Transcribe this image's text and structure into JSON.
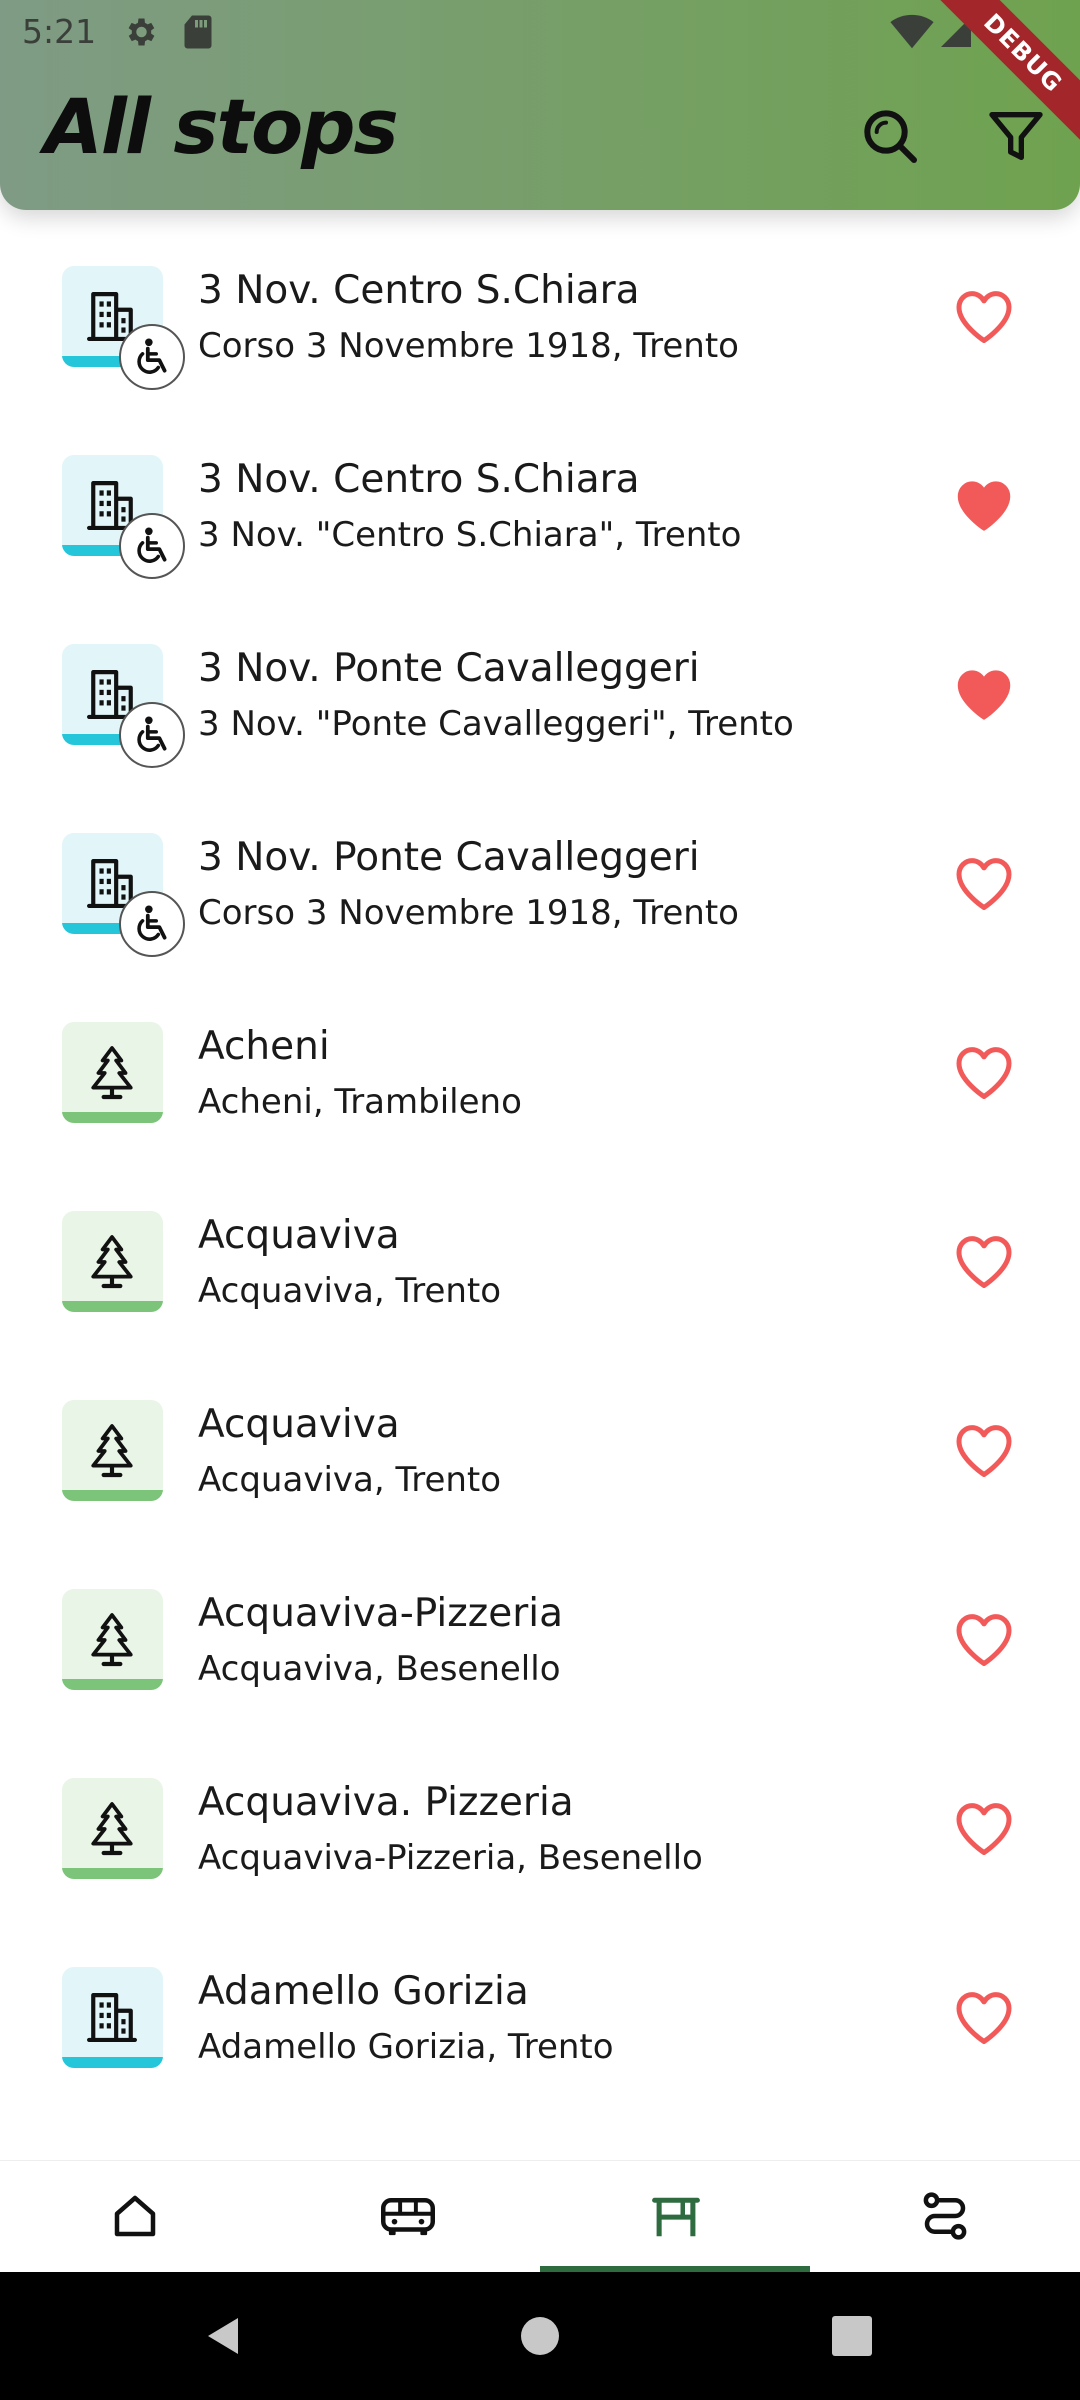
{
  "status_bar": {
    "time": "5:21"
  },
  "app_bar": {
    "title": "All stops",
    "debug_banner": "DEBUG"
  },
  "colors": {
    "urban_tile": "#e2f5f8",
    "urban_accent": "#26c6da",
    "rural_tile": "#e9f5e7",
    "rural_accent": "#7cc47a",
    "favorite": "#f25a5a",
    "nav_active": "#2e6b3f"
  },
  "stops": [
    {
      "name": "3 Nov. Centro S.Chiara",
      "address": "Corso 3 Novembre 1918, Trento",
      "type": "urban",
      "icon": "building-icon",
      "accessible": true,
      "favorite": false
    },
    {
      "name": "3 Nov. Centro S.Chiara",
      "address": "3 Nov. \"Centro S.Chiara\", Trento",
      "type": "urban",
      "icon": "building-icon",
      "accessible": true,
      "favorite": true
    },
    {
      "name": "3 Nov. Ponte Cavalleggeri",
      "address": "3 Nov. \"Ponte Cavalleggeri\", Trento",
      "type": "urban",
      "icon": "building-icon",
      "accessible": true,
      "favorite": true
    },
    {
      "name": "3 Nov. Ponte Cavalleggeri",
      "address": "Corso 3 Novembre 1918, Trento",
      "type": "urban",
      "icon": "building-icon",
      "accessible": true,
      "favorite": false
    },
    {
      "name": "Acheni",
      "address": "Acheni, Trambileno",
      "type": "rural",
      "icon": "tree-icon",
      "accessible": false,
      "favorite": false
    },
    {
      "name": "Acquaviva",
      "address": "Acquaviva, Trento",
      "type": "rural",
      "icon": "tree-icon",
      "accessible": false,
      "favorite": false
    },
    {
      "name": "Acquaviva",
      "address": "Acquaviva, Trento",
      "type": "rural",
      "icon": "tree-icon",
      "accessible": false,
      "favorite": false
    },
    {
      "name": "Acquaviva-Pizzeria",
      "address": "Acquaviva, Besenello",
      "type": "rural",
      "icon": "tree-icon",
      "accessible": false,
      "favorite": false
    },
    {
      "name": "Acquaviva. Pizzeria",
      "address": "Acquaviva-Pizzeria, Besenello",
      "type": "rural",
      "icon": "tree-icon",
      "accessible": false,
      "favorite": false
    },
    {
      "name": "Adamello Gorizia",
      "address": "Adamello Gorizia, Trento",
      "type": "urban",
      "icon": "building-icon",
      "accessible": false,
      "favorite": false
    }
  ],
  "bottom_nav": [
    {
      "icon": "home-icon",
      "active": false
    },
    {
      "icon": "bus-icon",
      "active": false
    },
    {
      "icon": "bus-stop-icon",
      "active": true
    },
    {
      "icon": "route-icon",
      "active": false
    }
  ]
}
